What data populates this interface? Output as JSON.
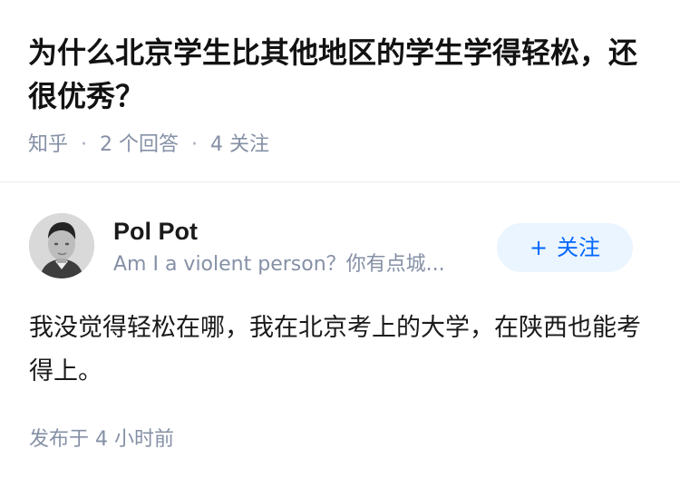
{
  "question": {
    "title": "为什么北京学生比其他地区的学生学得轻松，还很优秀？",
    "source": "知乎",
    "answers": "2 个回答",
    "followers": "4 关注",
    "separator": "·"
  },
  "answer": {
    "author_name": "Pol Pot",
    "author_bio": "Am I a violent person？你有点城...",
    "follow_plus": "+",
    "follow_label": "关注",
    "content": "我没觉得轻松在哪，我在北京考上的大学，在陕西也能考得上。",
    "published_time": "发布于  4 小时前"
  },
  "colors": {
    "accent": "#0066ff",
    "follow_bg": "#ebf5ff",
    "meta_text": "#8590a6"
  },
  "icons": {
    "avatar": "user-avatar-portrait"
  }
}
